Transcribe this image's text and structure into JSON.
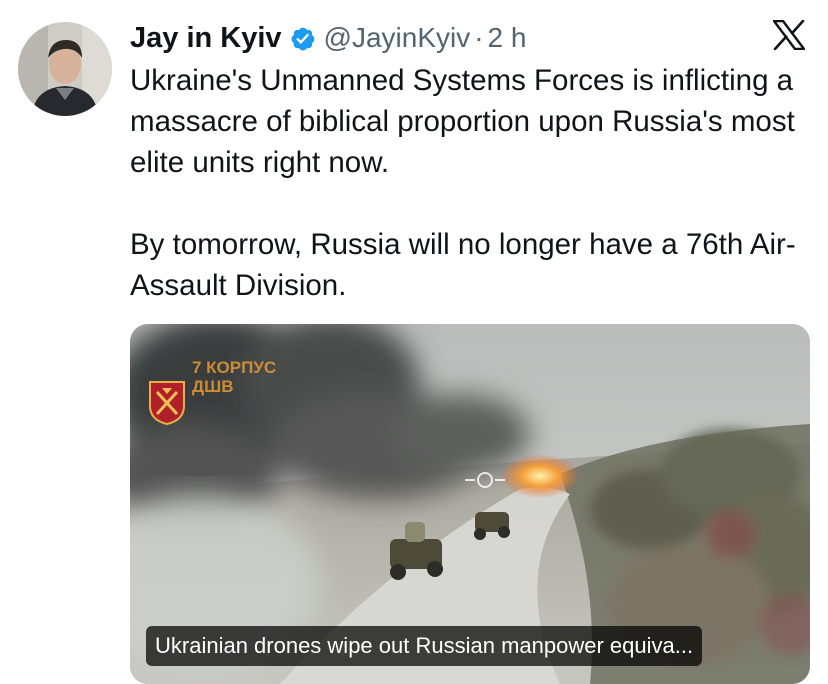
{
  "author": {
    "display_name": "Jay in Kyiv",
    "handle": "@JayinKyiv",
    "separator": "·",
    "timestamp": "2 h",
    "verified": true,
    "verified_color": "#1d9bf0"
  },
  "platform_logo": "x-logo-icon",
  "tweet": {
    "paragraph_1": "Ukraine's Unmanned Systems Forces is inflicting a massacre of biblical proportion upon Russia's most elite units right now.",
    "paragraph_2": "By tomorrow, Russia will no longer have a 76th Air-Assault Division."
  },
  "media": {
    "watermark_line_1": "7 КОРПУС",
    "watermark_line_2": "ДШВ",
    "caption": "Ukrainian drones wipe out Russian manpower equiva..."
  },
  "colors": {
    "text": "#0f1419",
    "secondary_text": "#536471",
    "caption_bg": "rgba(0,0,0,0.72)"
  }
}
